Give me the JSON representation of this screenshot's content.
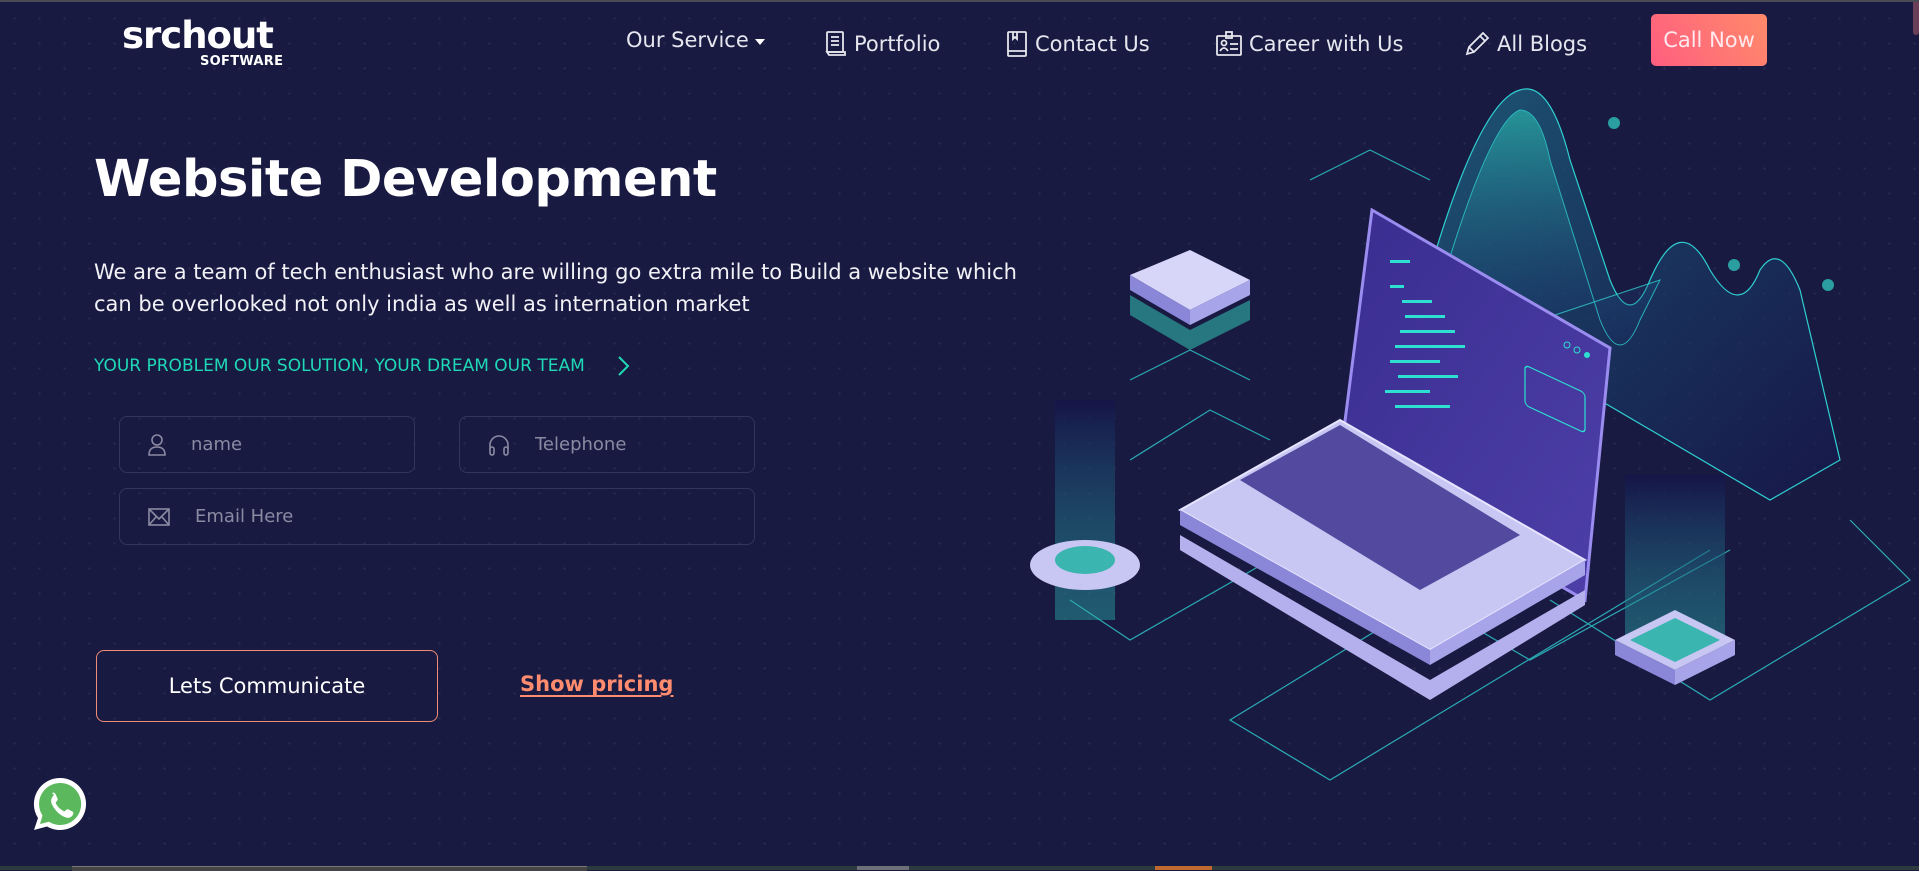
{
  "brand": {
    "name": "srchout",
    "sub": "SOFTWARE"
  },
  "nav": {
    "items": [
      {
        "label": "Our Service",
        "icon": "caret-down-icon"
      },
      {
        "label": "Portfolio",
        "icon": "document-icon"
      },
      {
        "label": "Contact Us",
        "icon": "book-icon"
      },
      {
        "label": "Career with Us",
        "icon": "id-card-icon"
      },
      {
        "label": "All Blogs",
        "icon": "pencil-icon"
      }
    ],
    "cta": "Call Now"
  },
  "hero": {
    "title": "Website Development",
    "description": "We are a team of tech enthusiast who are willing go extra mile to Build a website which can be overlooked not only india as well as internation market",
    "tagline": "YOUR PROBLEM OUR SOLUTION, YOUR DREAM OUR TEAM"
  },
  "form": {
    "name": {
      "placeholder": "name",
      "value": "",
      "icon": "user-icon"
    },
    "telephone": {
      "placeholder": "Telephone",
      "value": "",
      "icon": "headphones-icon"
    },
    "email": {
      "placeholder": "Email Here",
      "value": "",
      "icon": "envelope-icon"
    }
  },
  "actions": {
    "communicate": "Lets Communicate",
    "pricing": "Show pricing"
  },
  "colors": {
    "background": "#191a42",
    "accent_teal": "#1fd8b6",
    "accent_coral": "#ff8c6e",
    "cta_gradient_start": "#ff5e80",
    "cta_gradient_end": "#ff8a6a"
  }
}
